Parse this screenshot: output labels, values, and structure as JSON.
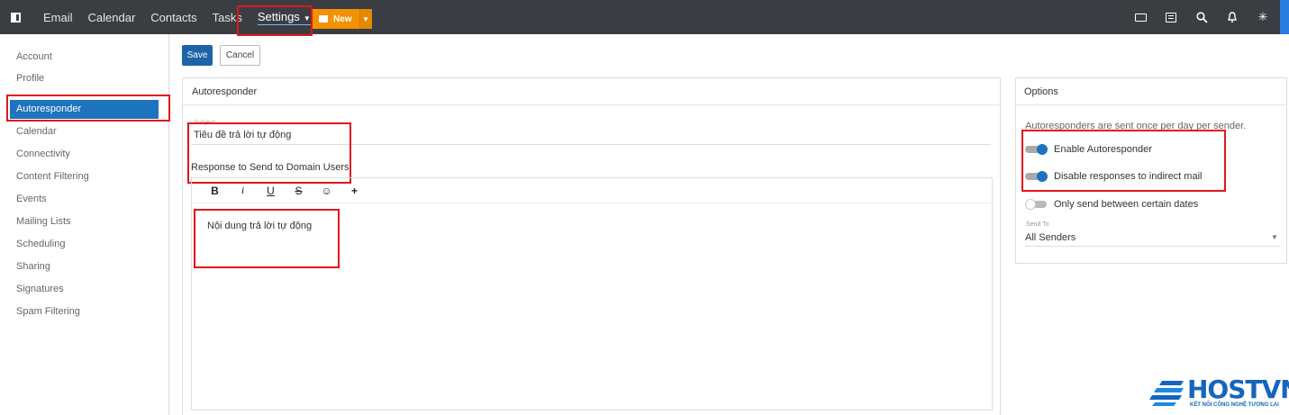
{
  "topnav": {
    "items": [
      "Email",
      "Calendar",
      "Contacts",
      "Tasks"
    ],
    "settings_label": "Settings",
    "new_label": "New"
  },
  "sidebar": {
    "items": [
      "Account",
      "Profile",
      "Autoresponder",
      "Calendar",
      "Connectivity",
      "Content Filtering",
      "Events",
      "Mailing Lists",
      "Scheduling",
      "Sharing",
      "Signatures",
      "Spam Filtering"
    ],
    "active_index": 2
  },
  "toolbar": {
    "save_label": "Save",
    "cancel_label": "Cancel"
  },
  "autoresponder": {
    "title": "Autoresponder",
    "subject_label": "Subject",
    "subject_value": "Tiêu đề trả lời tự động",
    "response_label": "Response to Send to Domain Users",
    "editor_buttons": [
      "B",
      "i",
      "U",
      "S",
      "☺",
      "+"
    ],
    "content": "Nội dung trả lời tự động"
  },
  "options": {
    "title": "Options",
    "note": "Autoresponders are sent once per day per sender.",
    "toggles": [
      {
        "label": "Enable Autoresponder",
        "on": true
      },
      {
        "label": "Disable responses to indirect mail",
        "on": true
      },
      {
        "label": "Only send between certain dates",
        "on": false
      }
    ],
    "send_to_label": "Send To",
    "send_to_value": "All Senders"
  },
  "logo": {
    "name": "HOSTVN",
    "tagline": "KẾT NỐI CÔNG NGHỆ TƯƠNG LAI"
  },
  "colors": {
    "topbar": "#3a3d42",
    "accent": "#1e73be",
    "new_button": "#f39200",
    "highlight": "#e0161c"
  }
}
